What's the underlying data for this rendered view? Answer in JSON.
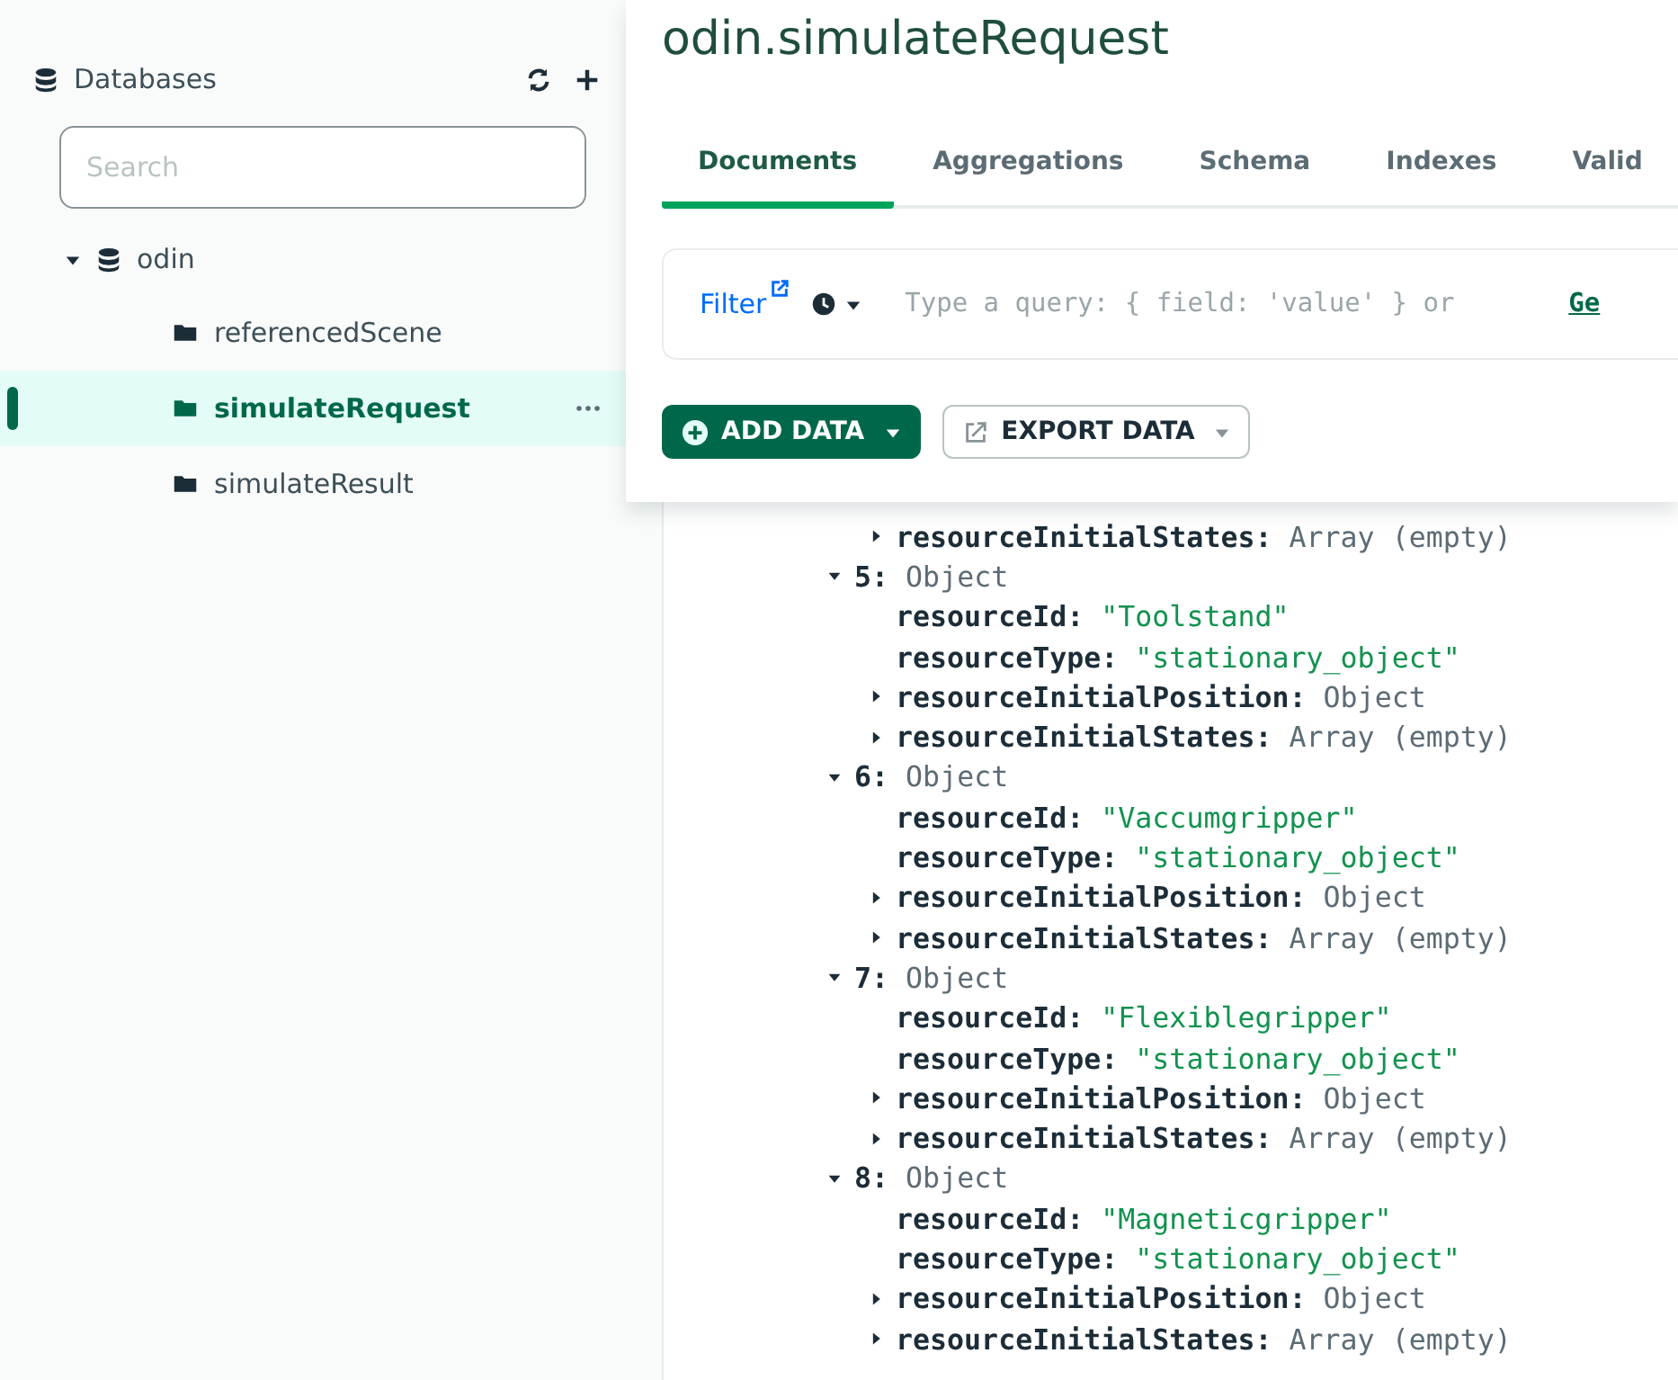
{
  "sidebar": {
    "header": "Databases",
    "search": {
      "placeholder": "Search"
    },
    "databases": [
      {
        "name": "odin",
        "expanded": true,
        "collections": [
          {
            "name": "referencedScene",
            "selected": false
          },
          {
            "name": "simulateRequest",
            "selected": true
          },
          {
            "name": "simulateResult",
            "selected": false
          }
        ]
      }
    ]
  },
  "title": "odin.simulateRequest",
  "tabs": [
    {
      "label": "Documents",
      "selected": true
    },
    {
      "label": "Aggregations",
      "selected": false
    },
    {
      "label": "Schema",
      "selected": false
    },
    {
      "label": "Indexes",
      "selected": false
    },
    {
      "label": "Valid",
      "selected": false
    }
  ],
  "filter": {
    "label": "Filter",
    "placeholder": "Type a query: { field: 'value' } or",
    "link": "Ge"
  },
  "buttons": [
    {
      "label": "ADD DATA",
      "kind": "primary"
    },
    {
      "label": "EXPORT DATA",
      "kind": "secondary"
    }
  ],
  "tree": [
    {
      "children": [
        {
          "key": "resourceInitialStates:",
          "value": "Array (empty)",
          "kind": "type",
          "expanded": false
        }
      ]
    },
    {
      "key": "5:",
      "value": "Object",
      "kind": "type",
      "expanded": true,
      "children": [
        {
          "key": "resourceId:",
          "value": "\"Toolstand\"",
          "kind": "string"
        },
        {
          "key": "resourceType:",
          "value": "\"stationary_object\"",
          "kind": "string"
        },
        {
          "key": "resourceInitialPosition:",
          "value": "Object",
          "kind": "type",
          "expanded": false
        },
        {
          "key": "resourceInitialStates:",
          "value": "Array (empty)",
          "kind": "type",
          "expanded": false
        }
      ]
    },
    {
      "key": "6:",
      "value": "Object",
      "kind": "type",
      "expanded": true,
      "children": [
        {
          "key": "resourceId:",
          "value": "\"Vaccumgripper\"",
          "kind": "string"
        },
        {
          "key": "resourceType:",
          "value": "\"stationary_object\"",
          "kind": "string"
        },
        {
          "key": "resourceInitialPosition:",
          "value": "Object",
          "kind": "type",
          "expanded": false
        },
        {
          "key": "resourceInitialStates:",
          "value": "Array (empty)",
          "kind": "type",
          "expanded": false
        }
      ]
    },
    {
      "key": "7:",
      "value": "Object",
      "kind": "type",
      "expanded": true,
      "children": [
        {
          "key": "resourceId:",
          "value": "\"Flexiblegripper\"",
          "kind": "string"
        },
        {
          "key": "resourceType:",
          "value": "\"stationary_object\"",
          "kind": "string"
        },
        {
          "key": "resourceInitialPosition:",
          "value": "Object",
          "kind": "type",
          "expanded": false
        },
        {
          "key": "resourceInitialStates:",
          "value": "Array (empty)",
          "kind": "type",
          "expanded": false
        }
      ]
    },
    {
      "key": "8:",
      "value": "Object",
      "kind": "type",
      "expanded": true,
      "children": [
        {
          "key": "resourceId:",
          "value": "\"Magneticgripper\"",
          "kind": "string"
        },
        {
          "key": "resourceType:",
          "value": "\"stationary_object\"",
          "kind": "string"
        },
        {
          "key": "resourceInitialPosition:",
          "value": "Object",
          "kind": "type",
          "expanded": false
        },
        {
          "key": "resourceInitialStates:",
          "value": "Array (empty)",
          "kind": "type",
          "expanded": false
        }
      ]
    }
  ]
}
